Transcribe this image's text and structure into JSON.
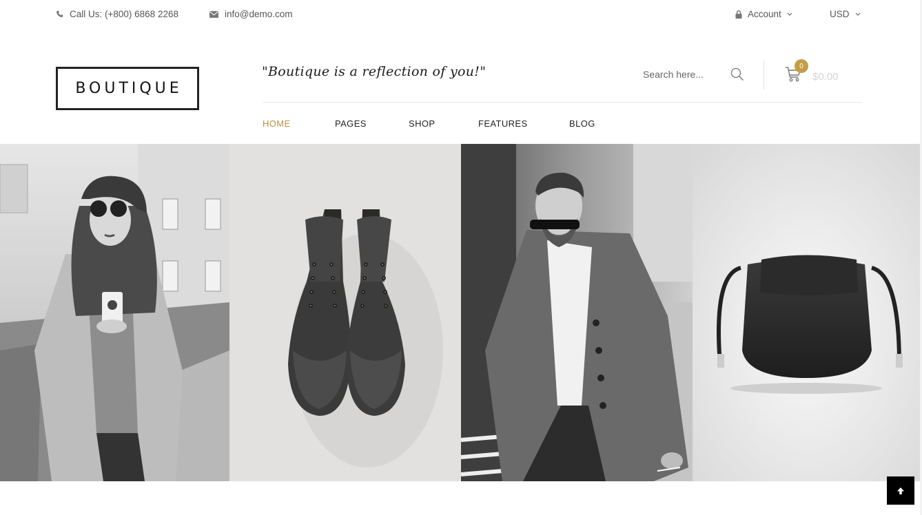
{
  "topbar": {
    "phone": "Call Us: (+800) 6868 2268",
    "email": "info@demo.com",
    "account": "Account",
    "currency": "USD"
  },
  "header": {
    "logo": "BOUTIQUE",
    "tagline": "\"Boutique is a reflection of you!\"",
    "search_placeholder": "Search here...",
    "cart_count": "0",
    "cart_total": "$0.00"
  },
  "nav": {
    "items": [
      {
        "label": "HOME",
        "active": true
      },
      {
        "label": "PAGES",
        "active": false
      },
      {
        "label": "SHOP",
        "active": false
      },
      {
        "label": "FEATURES",
        "active": false
      },
      {
        "label": "BLOG",
        "active": false
      }
    ]
  },
  "colors": {
    "accent": "#c59d44",
    "nav_active": "#b8913f",
    "text": "#222222",
    "muted": "#555555"
  },
  "icons": {
    "phone": "phone-icon",
    "email": "envelope-icon",
    "account": "lock-icon",
    "dropdown": "chevron-down-icon",
    "search": "search-icon",
    "cart": "cart-icon",
    "back_to_top": "arrow-up-icon"
  }
}
